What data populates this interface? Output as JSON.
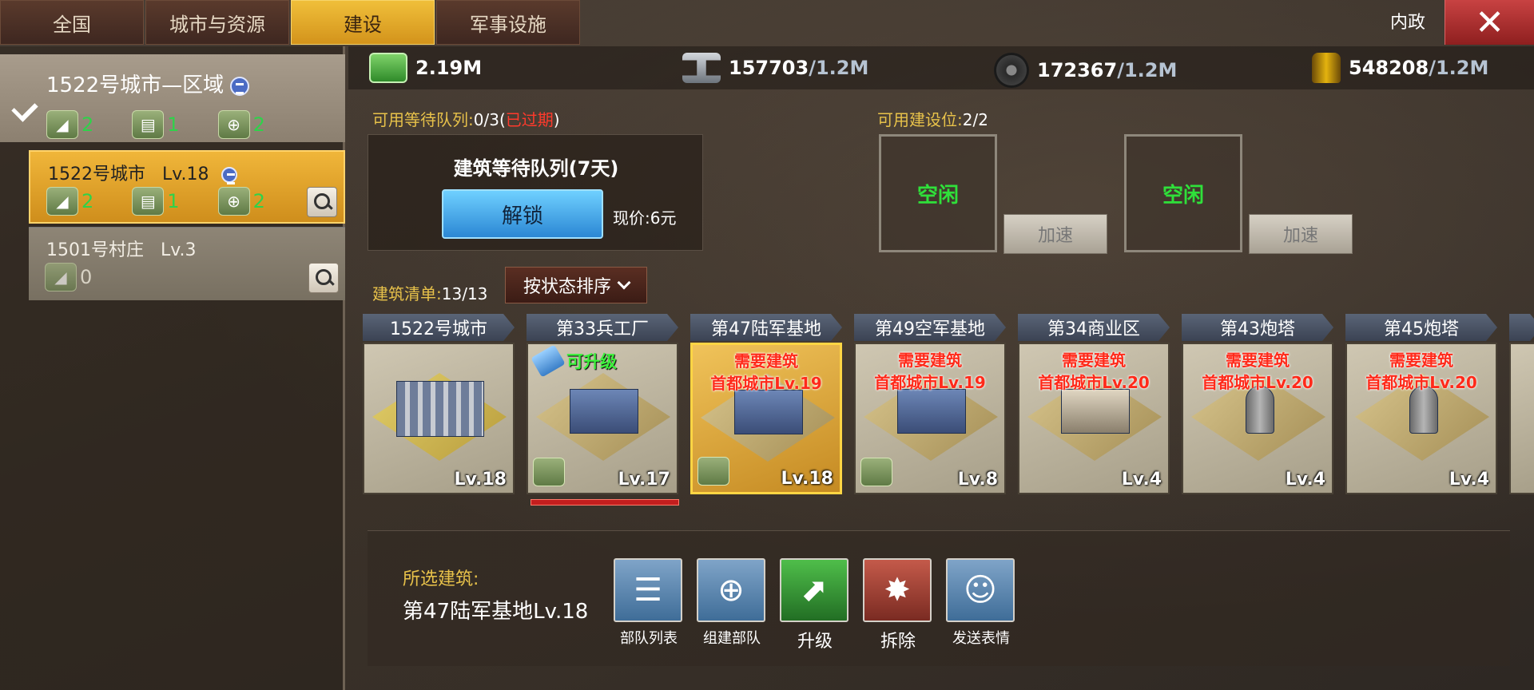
{
  "tabs": [
    "全国",
    "城市与资源",
    "建设",
    "军事设施"
  ],
  "active_tab": 2,
  "header": {
    "title": "内政",
    "close": "✕"
  },
  "region": {
    "title": "1522号城市—区域",
    "counts": [
      "2",
      "1",
      "2"
    ]
  },
  "cities": [
    {
      "name": "1522号城市",
      "level": "Lv.18",
      "counts": [
        "2",
        "1",
        "2"
      ]
    },
    {
      "name": "1501号村庄",
      "level": "Lv.3",
      "counts": [
        "0"
      ]
    }
  ],
  "resources": [
    {
      "icon": "money-icon",
      "value": "2.19M",
      "cap": ""
    },
    {
      "icon": "steel-icon",
      "value": "157703",
      "cap": "/1.2M"
    },
    {
      "icon": "rubber-icon",
      "value": "172367",
      "cap": "/1.2M"
    },
    {
      "icon": "oil-icon",
      "value": "548208",
      "cap": "/1.2M"
    }
  ],
  "queue": {
    "label": "可用等待队列:",
    "value": "0/3(",
    "expired": "已过期",
    "close_paren": ")",
    "title": "建筑等待队列(7天)",
    "unlock": "解锁",
    "price": "现价:6元"
  },
  "build_slots": {
    "label": "可用建设位:",
    "value": "2/2",
    "slots": [
      {
        "status": "空闲",
        "speed": "加速"
      },
      {
        "status": "空闲",
        "speed": "加速"
      }
    ]
  },
  "list": {
    "label": "建筑清单:",
    "value": "13/13",
    "sort": "按状态排序"
  },
  "buildings": [
    {
      "name": "1522号城市",
      "level": "Lv.18",
      "type": "city",
      "req1": "",
      "req2": "",
      "upgrade": "",
      "badge": false
    },
    {
      "name": "第33兵工厂",
      "level": "Lv.17",
      "type": "factory",
      "req1": "",
      "req2": "",
      "upgrade": "可升级",
      "badge": true
    },
    {
      "name": "第47陆军基地",
      "level": "Lv.18",
      "type": "base",
      "req1": "需要建筑",
      "req2": "首都城市Lv.19",
      "upgrade": "",
      "badge": true,
      "selected": true
    },
    {
      "name": "第49空军基地",
      "level": "Lv.8",
      "type": "air",
      "req1": "需要建筑",
      "req2": "首都城市Lv.19",
      "upgrade": "",
      "badge": true
    },
    {
      "name": "第34商业区",
      "level": "Lv.4",
      "type": "commerce",
      "req1": "需要建筑",
      "req2": "首都城市Lv.20",
      "upgrade": "",
      "badge": false
    },
    {
      "name": "第43炮塔",
      "level": "Lv.4",
      "type": "tower",
      "req1": "需要建筑",
      "req2": "首都城市Lv.20",
      "upgrade": "",
      "badge": false
    },
    {
      "name": "第45炮塔",
      "level": "Lv.4",
      "type": "tower",
      "req1": "需要建筑",
      "req2": "首都城市Lv.20",
      "upgrade": "",
      "badge": false
    }
  ],
  "selected": {
    "label": "所选建筑:",
    "value": "第47陆军基地Lv.18"
  },
  "actions": [
    {
      "label": "部队列表",
      "icon": "troop-list-icon"
    },
    {
      "label": "组建部队",
      "icon": "form-troop-icon"
    },
    {
      "label": "升级",
      "icon": "upgrade-arrow-icon"
    },
    {
      "label": "拆除",
      "icon": "demolish-icon"
    },
    {
      "label": "发送表情",
      "icon": "emoji-icon"
    }
  ]
}
